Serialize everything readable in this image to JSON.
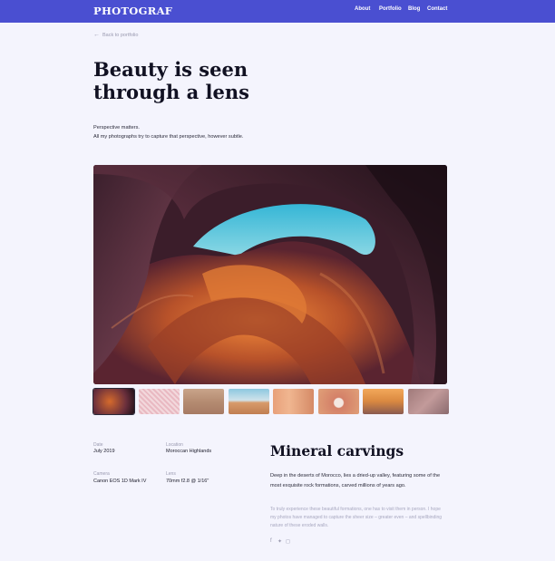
{
  "header": {
    "logo": "PHOTOGRAF",
    "nav": [
      "About",
      "Portfolio",
      "Blog",
      "Contact"
    ]
  },
  "back_link": "Back to portfolio",
  "title": "Beauty is seen through a lens",
  "intro": {
    "line1": "Perspective matters.",
    "line2": "All my photographs try to capture that perspective, however subtle."
  },
  "details": {
    "date_label": "Date",
    "date_value": "July 2019",
    "location_label": "Location",
    "location_value": "Moroccan Highlands",
    "camera_label": "Camera",
    "camera_value": "Canon EOS 1D Mark IV",
    "lens_label": "Lens",
    "lens_value": "70mm f2.8 @ 1/16\""
  },
  "subtitle": "Mineral carvings",
  "description_1": "Deep in the deserts of Morocco, lies a dried-up valley, featuring some of the most exquisite rock formations, carved millions of years ago.",
  "description_2": "To truly experience these beautiful formations, one has to visit them in person. I hope my photos have managed to capture the sheer size – greater even – and spellbinding nature of these eroded walls.",
  "social_icons": [
    "facebook-icon",
    "twitter-icon",
    "instagram-icon"
  ],
  "colors": {
    "brand": "#4a4fd1",
    "background": "#f4f4fd",
    "text": "#1b1b2a",
    "muted": "#9a9ab0"
  }
}
